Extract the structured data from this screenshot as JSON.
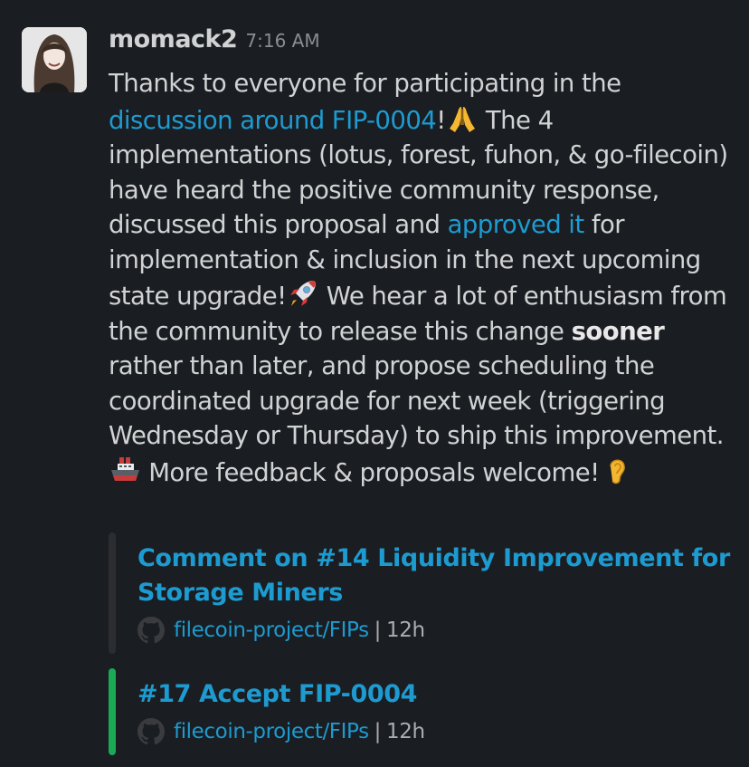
{
  "message": {
    "username": "momack2",
    "timestamp": "7:16 AM",
    "text_1": "Thanks to everyone for participating in the ",
    "link_discussion": "discussion around FIP-0004",
    "text_2": "!",
    "text_3": " The 4 implementations (lotus, forest, fuhon, & go-filecoin) have heard the positive community response, discussed this proposal and ",
    "link_approved": "approved it",
    "text_4": " for implementation & inclusion in the next upcoming state upgrade!",
    "text_5": " We hear a lot of enthusiasm from the community to release this change ",
    "bold_sooner": "sooner",
    "text_6": " rather than later, and propose scheduling the coordinated upgrade for next week (triggering Wednesday or Thursday) to ship this improvement.",
    "text_7": " More feedback & proposals welcome!",
    "emojis": [
      "folded-hands",
      "rocket",
      "ship",
      "ear"
    ]
  },
  "attachments": [
    {
      "title": "Comment on #14 Liquidity Improvement for Storage Miners",
      "repo": "filecoin-project/FIPs",
      "separator": "|",
      "age": "12h",
      "bar_color": "#2c2d30"
    },
    {
      "title": "#17 Accept FIP-0004",
      "repo": "filecoin-project/FIPs",
      "separator": "|",
      "age": "12h",
      "bar_color": "#1aaa55"
    }
  ]
}
